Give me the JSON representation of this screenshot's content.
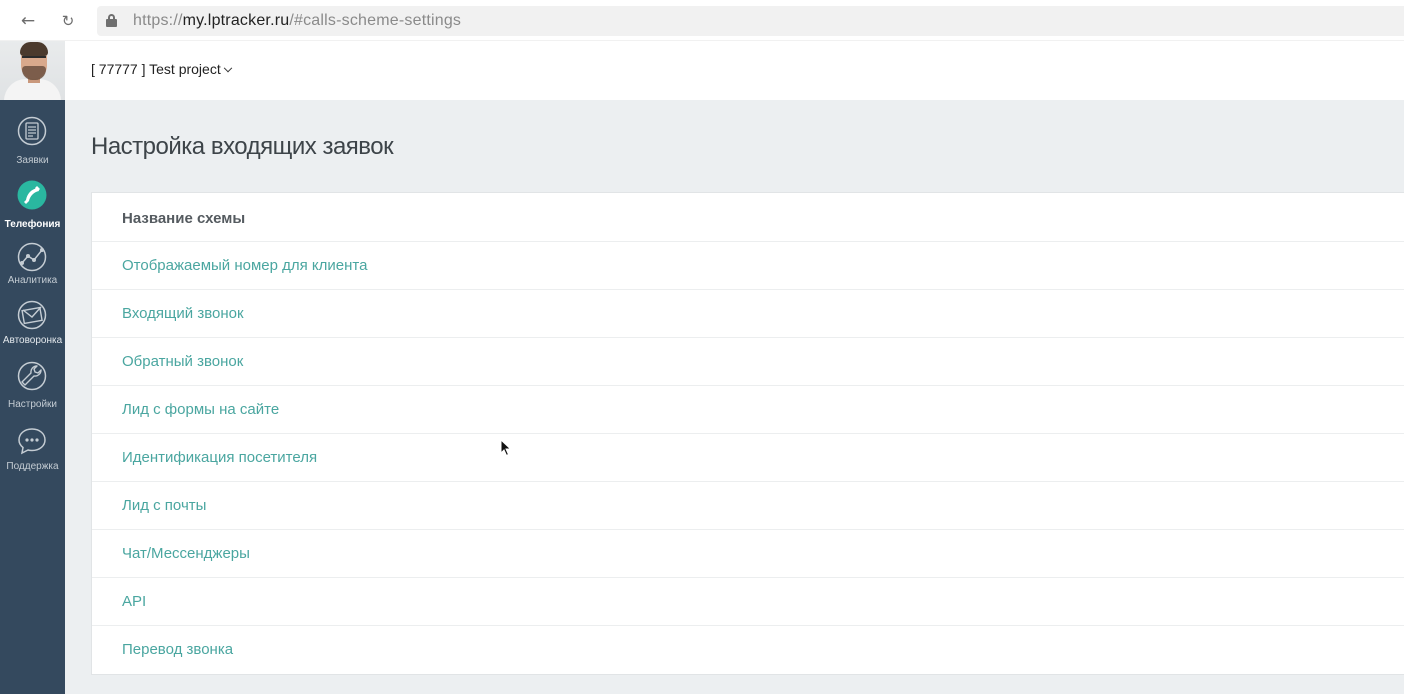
{
  "browser": {
    "url": {
      "scheme": "https://",
      "host": "my.lptracker.ru",
      "path": "/#calls-scheme-settings"
    },
    "back_icon": "arrow-left-icon",
    "reload_icon": "reload-icon"
  },
  "sidebar": {
    "avatar": "user-avatar",
    "items": [
      {
        "label": "Заявки",
        "icon": "list-icon",
        "active": false
      },
      {
        "label": "Телефония",
        "icon": "phone-icon",
        "active": true
      },
      {
        "label": "Аналитика",
        "icon": "analytics-icon",
        "active": false
      },
      {
        "label": "Автоворонка",
        "icon": "mail-icon",
        "active": false
      },
      {
        "label": "Настройки",
        "icon": "wrench-icon",
        "active": false
      },
      {
        "label": "Поддержка",
        "icon": "chat-icon",
        "active": false
      }
    ]
  },
  "header": {
    "project": "[ 77777 ] Test project"
  },
  "main": {
    "title": "Настройка входящих заявок",
    "table": {
      "header": "Название схемы",
      "rows": [
        "Отображаемый номер для клиента",
        "Входящий звонок",
        "Обратный звонок",
        "Лид с формы на сайте",
        "Идентификация посетителя",
        "Лид с почты",
        "Чат/Мессенджеры",
        "API",
        "Перевод звонка"
      ]
    }
  },
  "colors": {
    "sidebar_bg": "#34495e",
    "link": "#4aa6a0",
    "accent": "#2ab7a0",
    "main_bg": "#eceff1"
  }
}
